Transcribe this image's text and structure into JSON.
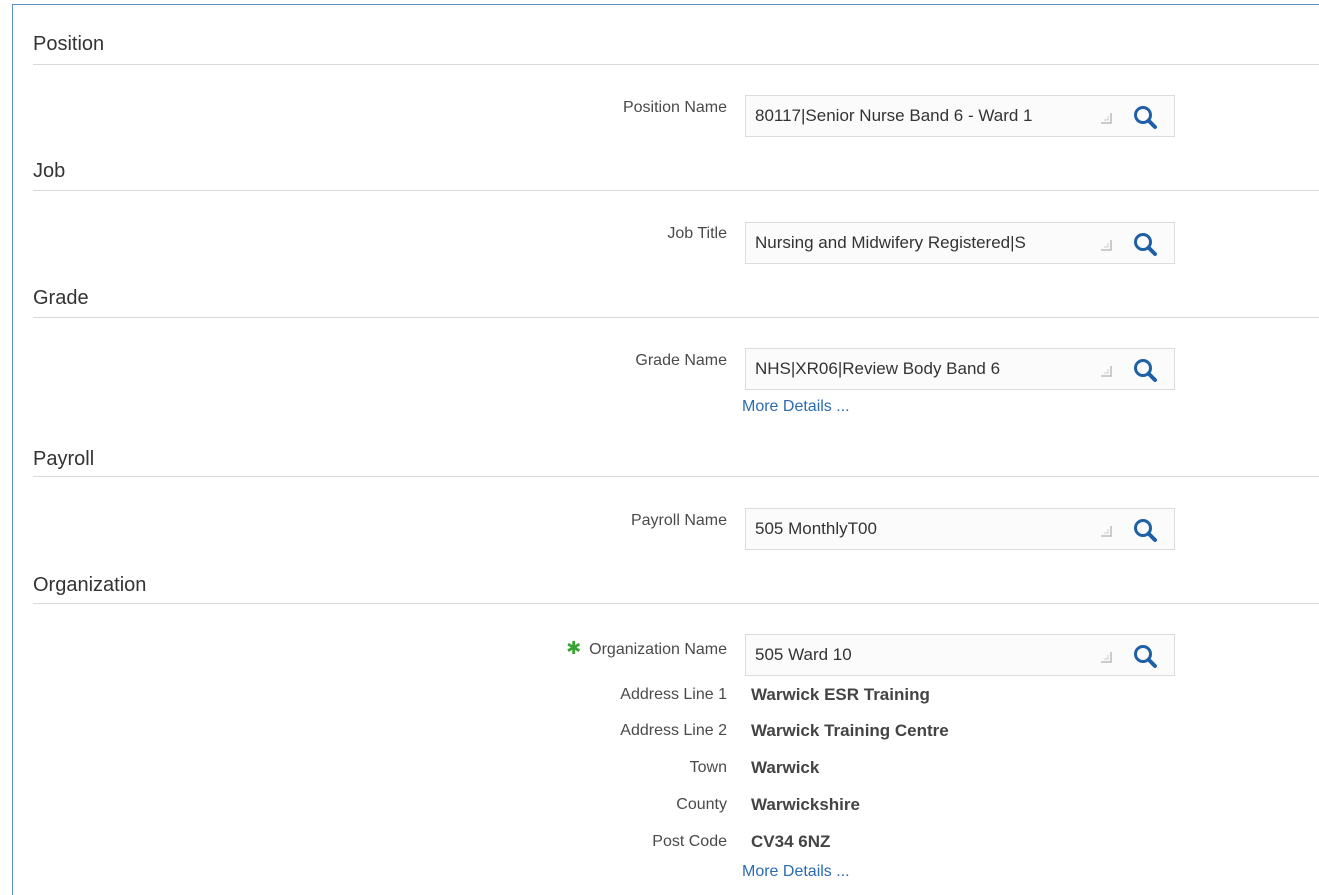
{
  "sections": {
    "position": {
      "header": "Position",
      "label": "Position Name",
      "value": "80117|Senior Nurse Band 6 - Ward 1"
    },
    "job": {
      "header": "Job",
      "label": "Job Title",
      "value": "Nursing and Midwifery Registered|S"
    },
    "grade": {
      "header": "Grade",
      "label": "Grade Name",
      "value": "NHS|XR06|Review Body Band 6",
      "link": "More Details ..."
    },
    "payroll": {
      "header": "Payroll",
      "label": "Payroll Name",
      "value": "505 MonthlyT00"
    },
    "organization": {
      "header": "Organization",
      "required_mark": "✱",
      "label": "Organization Name",
      "value": "505 Ward 10",
      "address": {
        "line1_label": "Address Line 1",
        "line1_value": "Warwick ESR Training",
        "line2_label": "Address Line 2",
        "line2_value": "Warwick Training Centre",
        "town_label": "Town",
        "town_value": "Warwick",
        "county_label": "County",
        "county_value": "Warwickshire",
        "postcode_label": "Post Code",
        "postcode_value": "CV34 6NZ"
      },
      "link": "More Details ..."
    }
  },
  "icons": {
    "search": "search-icon",
    "resize": "resize-handle-icon"
  },
  "colors": {
    "link": "#2b6cb0",
    "search_icon": "#1f5fa8",
    "required": "#3aa335",
    "frame_border": "#5b8fd0"
  }
}
